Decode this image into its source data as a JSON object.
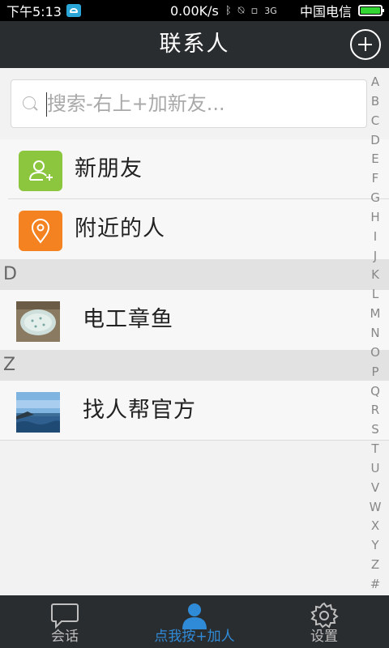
{
  "status_bar": {
    "time": "下午5:13",
    "network_speed": "0.00K/s",
    "carrier": "中国电信",
    "signal_label": "3G",
    "battery_level": 1.0
  },
  "header": {
    "title": "联系人",
    "add_icon": "plus-circle-icon"
  },
  "search": {
    "placeholder": "搜索-右上+加新友..."
  },
  "fixed_items": [
    {
      "label": "新朋友",
      "icon": "add-person-icon",
      "color": "#8cc63f"
    },
    {
      "label": "附近的人",
      "icon": "location-pin-icon",
      "color": "#f58220"
    }
  ],
  "sections": [
    {
      "letter": "D",
      "contacts": [
        {
          "name": "电工章鱼"
        }
      ]
    },
    {
      "letter": "Z",
      "contacts": [
        {
          "name": "找人帮官方"
        }
      ]
    }
  ],
  "alphabet_index": [
    "A",
    "B",
    "C",
    "D",
    "E",
    "F",
    "G",
    "H",
    "I",
    "J",
    "K",
    "L",
    "M",
    "N",
    "O",
    "P",
    "Q",
    "R",
    "S",
    "T",
    "U",
    "V",
    "W",
    "X",
    "Y",
    "Z",
    "#"
  ],
  "tabs": [
    {
      "label": "会话",
      "icon": "chat-bubble-icon",
      "active": false
    },
    {
      "label": "点我按+加人",
      "icon": "person-icon",
      "active": true
    },
    {
      "label": "设置",
      "icon": "gear-icon",
      "active": false
    }
  ],
  "colors": {
    "title_bar": "#2a2d30",
    "active_tab": "#2f8bd8"
  }
}
